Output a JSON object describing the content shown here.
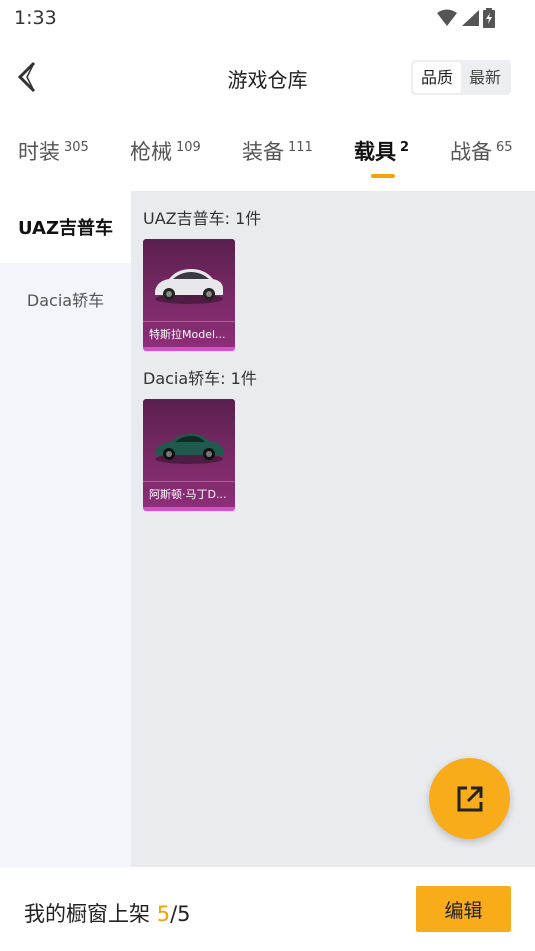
{
  "status_bar": {
    "time": "1:33",
    "icons": [
      "wifi-icon",
      "signal-icon",
      "battery-charging-icon"
    ]
  },
  "header": {
    "title": "游戏仓库",
    "back_icon": "chevron-left-icon",
    "sort": [
      "品质",
      "最新"
    ],
    "sort_selected": "品质"
  },
  "tabs": [
    {
      "label": "时装",
      "count": "305"
    },
    {
      "label": "枪械",
      "count": "109"
    },
    {
      "label": "装备",
      "count": "111"
    },
    {
      "label": "载具",
      "count": "2"
    },
    {
      "label": "战备",
      "count": "65"
    }
  ],
  "active_tab": "载具",
  "sidebar": {
    "items": [
      "UAZ吉普车",
      "Dacia轿车"
    ],
    "active": "UAZ吉普车"
  },
  "groups": [
    {
      "title": "UAZ吉普车: 1件",
      "items": [
        {
          "name": "特斯拉Model..."
        }
      ]
    },
    {
      "title": "Dacia轿车: 1件",
      "items": [
        {
          "name": "阿斯顿·马丁D..."
        }
      ]
    }
  ],
  "fab": {
    "icon": "share-external-icon"
  },
  "footer": {
    "label": "我的橱窗上架 ",
    "count": "5",
    "total": "/5",
    "edit_label": "编辑"
  },
  "colors": {
    "accent": "#f8ac1a",
    "card_bg": "#7a2a66",
    "card_border": "#d64fd0"
  }
}
